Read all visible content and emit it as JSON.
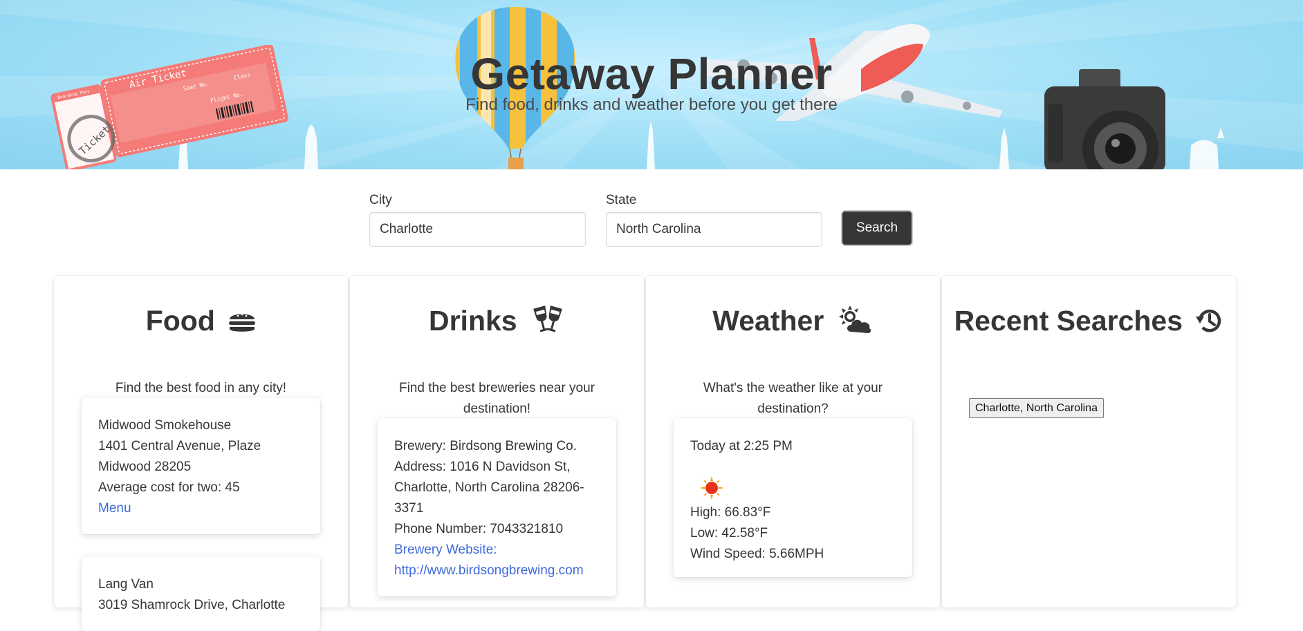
{
  "header": {
    "title": "Getaway Planner",
    "subtitle": "Find food, drinks and weather before you get there",
    "ticket": {
      "title": "Air Ticket",
      "stub_title": "Boarding Pass",
      "stamp": "Ticket",
      "seat_label": "Seat No.",
      "class_label": "Class",
      "flight_label": "Flight No."
    }
  },
  "search": {
    "city_label": "City",
    "city_value": "Charlotte",
    "state_label": "State",
    "state_value": "North Carolina",
    "button_label": "Search"
  },
  "food": {
    "title": "Food",
    "icon": "hamburger-icon",
    "description": "Find the best food in any city!",
    "results": [
      {
        "name": "Midwood Smokehouse",
        "address_line1": "1401 Central Avenue, Plaze",
        "address_line2": "Midwood 28205",
        "cost": "Average cost for two: 45",
        "menu_label": "Menu"
      },
      {
        "name": "Lang Van",
        "address_line1": "3019 Shamrock Drive, Charlotte"
      }
    ]
  },
  "drinks": {
    "title": "Drinks",
    "icon": "glass-cheers-icon",
    "description": "Find the best breweries near your destination!",
    "result": {
      "brewery": "Brewery: Birdsong Brewing Co.",
      "address": "Address: 1016 N Davidson St, Charlotte, North Carolina 28206-3371",
      "phone": "Phone Number: 7043321810",
      "website_label": "Brewery Website:",
      "website_url": "http://www.birdsongbrewing.com"
    }
  },
  "weather": {
    "title": "Weather",
    "icon": "cloud-sun-icon",
    "description": "What's the weather like at your destination?",
    "result": {
      "time": "Today at 2:25 PM",
      "condition_icon": "sun-icon",
      "high": "High: 66.83°F",
      "low": "Low: 42.58°F",
      "wind": "Wind Speed: 5.66MPH"
    }
  },
  "recent": {
    "title": "Recent Searches",
    "icon": "history-icon",
    "items": [
      "Charlotte, North Carolina"
    ]
  },
  "colors": {
    "hero_sky": "#9fdff7",
    "dark_button": "#363636",
    "link": "#3e6ad8",
    "ticket": "#f47b78"
  }
}
